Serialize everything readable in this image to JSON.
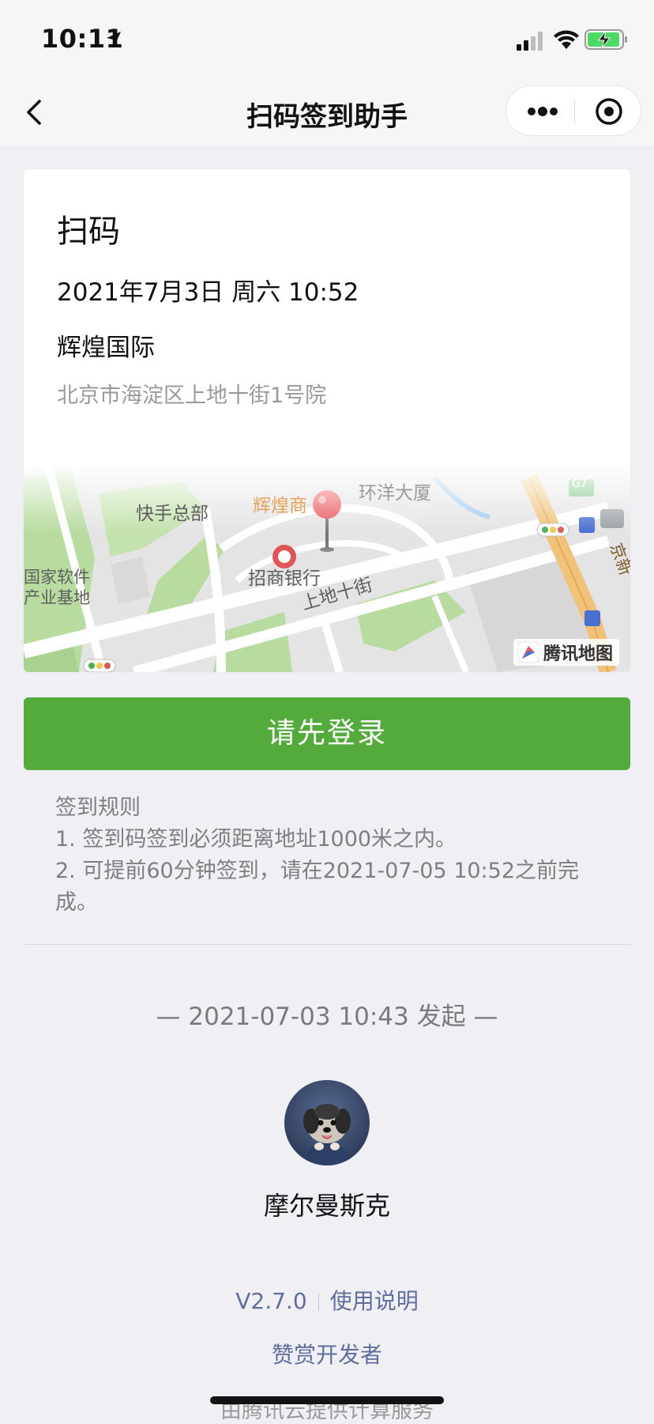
{
  "status_bar": {
    "time": "10:11"
  },
  "nav": {
    "title": "扫码签到助手"
  },
  "event": {
    "type": "扫码",
    "datetime": "2021年7月3日 周六 10:52",
    "place": "辉煌国际",
    "address": "北京市海淀区上地十街1号院"
  },
  "map": {
    "labels": {
      "kuaishou": "快手总部",
      "huihuang": "辉煌商",
      "huanyang": "环洋大厦",
      "cmb": "招商银行",
      "street": "上地十街",
      "guojia1": "国家软件",
      "guojia2": "产业基地",
      "jing": "京新",
      "g7": "G7"
    },
    "provider": "腾讯地图",
    "colors": {
      "road": "#ffffff",
      "green": "#b8dca0",
      "block": "#e2e2e2",
      "highway": "#f1c27a",
      "pin": "#e9555a"
    }
  },
  "actions": {
    "login_label": "请先登录"
  },
  "rules": {
    "title": "签到规则",
    "items": [
      "1. 签到码签到必须距离地址1000米之内。",
      "2. 可提前60分钟签到，请在2021-07-05 10:52之前完",
      "成。"
    ]
  },
  "meta": {
    "initiated": "— 2021-07-03 10:43 发起 —"
  },
  "initiator": {
    "name": "摩尔曼斯克"
  },
  "footer": {
    "version": "V2.7.0",
    "help_link": "使用说明",
    "appreciate": "赞赏开发者",
    "provided_by": "由腾讯云提供计算服务"
  },
  "theme": {
    "accent": "#53ab3c",
    "link": "#5f6e9e"
  }
}
